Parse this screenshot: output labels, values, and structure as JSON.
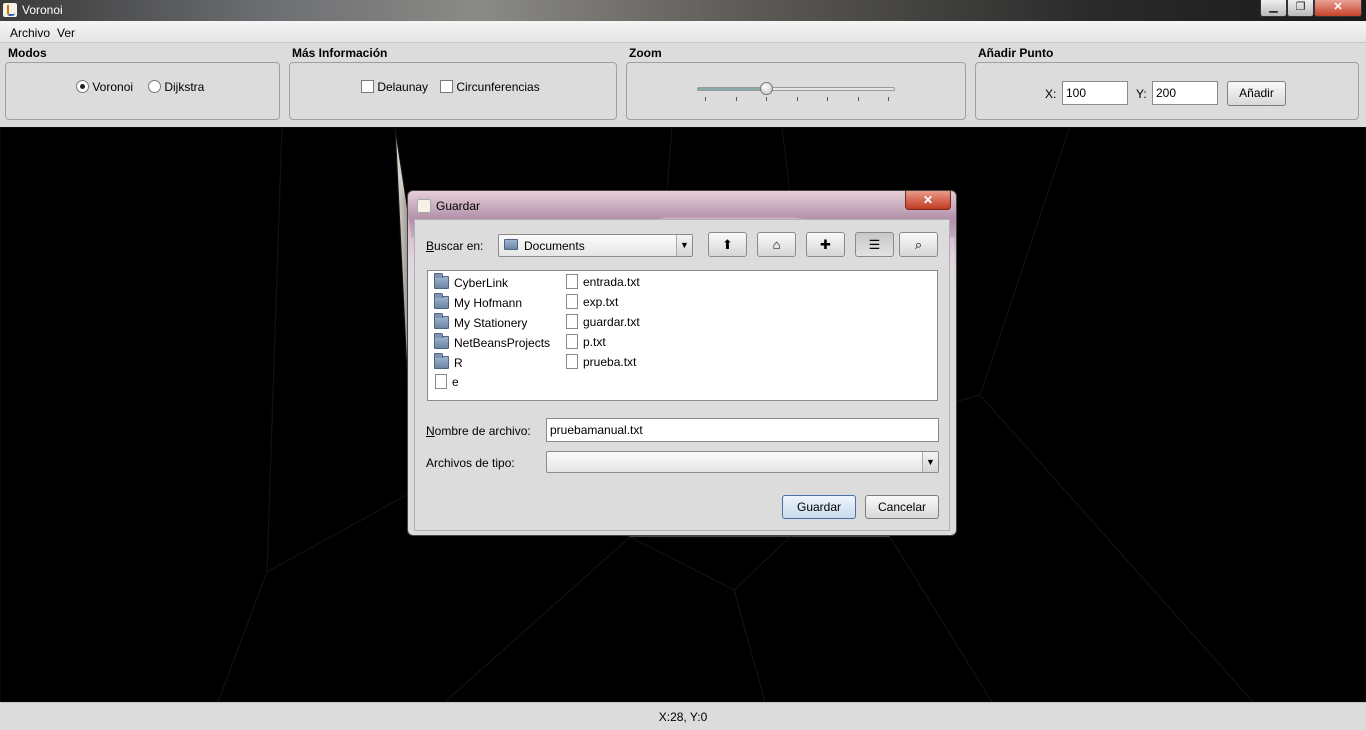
{
  "window": {
    "title": "Voronoi"
  },
  "window_controls": {
    "minimize": "▁",
    "maximize": "❐",
    "close": "✕"
  },
  "menu": {
    "items": [
      "Archivo",
      "Ver"
    ]
  },
  "groups": {
    "modes": {
      "title": "Modos",
      "options": [
        "Voronoi",
        "Dijkstra"
      ],
      "selected": "Voronoi"
    },
    "info": {
      "title": "Más Información",
      "options": [
        "Delaunay",
        "Circunferencias"
      ],
      "checked": [
        false,
        false
      ]
    },
    "zoom": {
      "title": "Zoom",
      "value_fraction": 0.35
    },
    "add_point": {
      "title": "Añadir Punto",
      "x_label": "X:",
      "x_value": "100",
      "y_label": "Y:",
      "y_value": "200",
      "button": "Añadir"
    }
  },
  "status": {
    "coords": "X:28, Y:0"
  },
  "canvas": {
    "region_colors": [
      "#b800ff",
      "#00f060",
      "#ff0a7a",
      "#ff9900",
      "#ff0044",
      "#00e0f0",
      "#00ffff",
      "#ffff00",
      "#ff1200",
      "#1010e8",
      "#ffa500"
    ]
  },
  "dialog": {
    "title": "Guardar",
    "close": "✕",
    "look_in_label": "Buscar en:",
    "look_in_value": "Documents",
    "toolbar_icons": [
      "up-folder-icon",
      "home-icon",
      "new-folder-icon",
      "list-view-icon",
      "details-view-icon"
    ],
    "folders": [
      "CyberLink",
      "My Hofmann",
      "My Stationery",
      "NetBeansProjects",
      "R"
    ],
    "files_col1": [
      "e"
    ],
    "files_col2": [
      "entrada.txt",
      "exp.txt",
      "guardar.txt",
      "p.txt",
      "prueba.txt"
    ],
    "filename_label": "Nombre de archivo:",
    "filename_value": "pruebamanual.txt",
    "filetype_label": "Archivos de tipo:",
    "filetype_value": "",
    "save_button": "Guardar",
    "cancel_button": "Cancelar"
  }
}
